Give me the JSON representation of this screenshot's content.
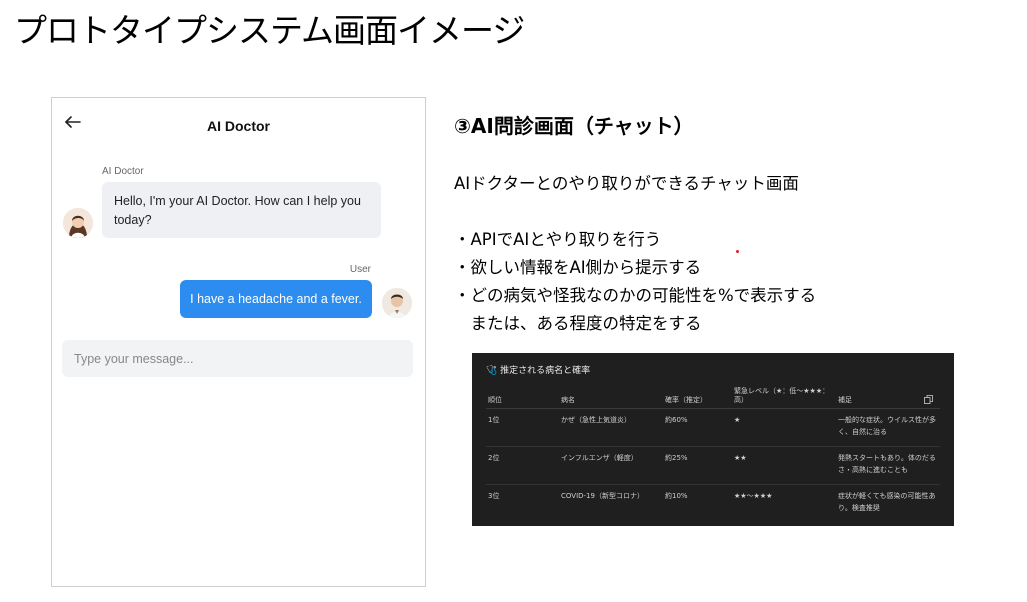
{
  "slide_title": "プロトタイプシステム画面イメージ",
  "chat": {
    "title": "AI Doctor",
    "messages": [
      {
        "sender": "AI Doctor",
        "text": "Hello, I'm your AI Doctor. How can I help you today?",
        "avatar": "female-doctor-avatar"
      },
      {
        "sender": "User",
        "text": "I have a headache and a fever.",
        "avatar": "male-user-avatar"
      }
    ],
    "input_placeholder": "Type your message...",
    "back_icon": "arrow-left-icon",
    "user_bubble_color": "#2d8cf0",
    "ai_bubble_color": "#eef0f3"
  },
  "description": {
    "heading": "③AI問診画面（チャット）",
    "summary": "AIドクターとのやり取りができるチャット画面",
    "bullets": [
      "・APIでAIとやり取りを行う",
      "・欲しい情報をAI側から提示する",
      "・どの病気や怪我なのかの可能性を%で表示する",
      "　または、ある程度の特定をする"
    ]
  },
  "diagnosis_panel": {
    "title": "🩺 推定される病名と確率",
    "columns": [
      "順位",
      "病名",
      "確率（推定）",
      "緊急レベル（★：低〜★★★：高）",
      "補足"
    ],
    "rows": [
      [
        "1位",
        "かぜ（急性上気道炎）",
        "約60%",
        "★",
        "一般的な症状。ウイルス性が多く、自然に治る"
      ],
      [
        "2位",
        "インフルエンザ（軽度）",
        "約25%",
        "★★",
        "発熱スタートもあり。体のだるさ・高熱に進むことも"
      ],
      [
        "3位",
        "COVID-19（新型コロナ）",
        "約10%",
        "★★〜★★★",
        "症状が軽くても感染の可能性あり。検査推奨"
      ]
    ],
    "background": "#1f1f1f"
  }
}
